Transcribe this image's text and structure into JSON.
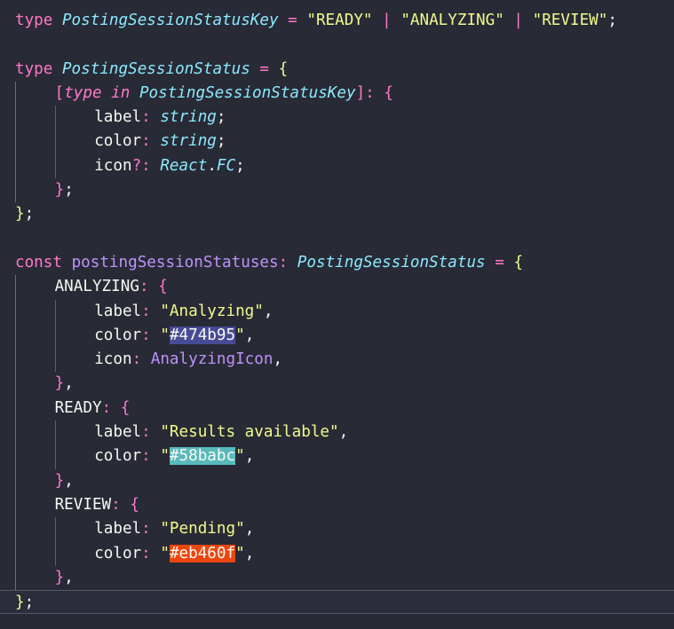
{
  "colors": {
    "background": "#282a36",
    "keyword": "#ff79c6",
    "type": "#8be9fd",
    "string": "#f1fa8c",
    "identifier": "#bd93f9",
    "swatch_analyzing": "#474b95",
    "swatch_ready": "#58babc",
    "swatch_review": "#eb460f"
  },
  "code": {
    "l1": {
      "kw": "type",
      "name": "PostingSessionStatusKey",
      "eq": " = ",
      "s1": "\"READY\"",
      "bar1": " | ",
      "s2": "\"ANALYZING\"",
      "bar2": " | ",
      "s3": "\"REVIEW\"",
      "end": ";"
    },
    "l3": {
      "kw": "type",
      "name": "PostingSessionStatus",
      "eq": " = ",
      "open": "{"
    },
    "l4": {
      "open": "[",
      "kw": "type",
      "in": " in ",
      "key": "PostingSessionStatusKey",
      "close": "]",
      "colon": ": ",
      "brace": "{"
    },
    "l5": {
      "prop": "label",
      "colon": ": ",
      "type": "string",
      "end": ";"
    },
    "l6": {
      "prop": "color",
      "colon": ": ",
      "type": "string",
      "end": ";"
    },
    "l7": {
      "prop": "icon",
      "opt": "?:",
      "sp": " ",
      "ns": "React",
      "dot": ".",
      "fc": "FC",
      "end": ";"
    },
    "l8": {
      "close": "}",
      "end": ";"
    },
    "l9": {
      "close": "}",
      "end": ";"
    },
    "l11": {
      "kw": "const",
      "name": "postingSessionStatuses",
      "colon": ": ",
      "type": "PostingSessionStatus",
      "eq": " = ",
      "open": "{"
    },
    "l12": {
      "key": "ANALYZING",
      "colon": ": ",
      "open": "{"
    },
    "l13": {
      "prop": "label",
      "colon": ": ",
      "val": "\"Analyzing\"",
      "end": ","
    },
    "l14": {
      "prop": "color",
      "colon": ": ",
      "q1": "\"",
      "hex": "#474b95",
      "q2": "\"",
      "end": ","
    },
    "l15": {
      "prop": "icon",
      "colon": ": ",
      "val": "AnalyzingIcon",
      "end": ","
    },
    "l16": {
      "close": "}",
      "end": ","
    },
    "l17": {
      "key": "READY",
      "colon": ": ",
      "open": "{"
    },
    "l18": {
      "prop": "label",
      "colon": ": ",
      "val": "\"Results available\"",
      "end": ","
    },
    "l19": {
      "prop": "color",
      "colon": ": ",
      "q1": "\"",
      "hex": "#58babc",
      "q2": "\"",
      "end": ","
    },
    "l20": {
      "close": "}",
      "end": ","
    },
    "l21": {
      "key": "REVIEW",
      "colon": ": ",
      "open": "{"
    },
    "l22": {
      "prop": "label",
      "colon": ": ",
      "val": "\"Pending\"",
      "end": ","
    },
    "l23": {
      "prop": "color",
      "colon": ": ",
      "q1": "\"",
      "hex": "#eb460f",
      "q2": "\"",
      "end": ","
    },
    "l24": {
      "close": "}",
      "end": ","
    },
    "l25": {
      "close": "}",
      "end": ";"
    }
  }
}
